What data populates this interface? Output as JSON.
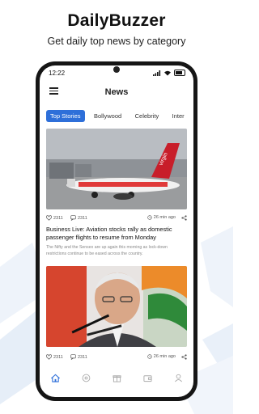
{
  "header": {
    "app_title": "DailyBuzzer",
    "subtitle": "Get daily top news by category"
  },
  "status_bar": {
    "time": "12:22"
  },
  "app_bar": {
    "title": "News",
    "menu_icon": "hamburger-menu-icon"
  },
  "tabs": [
    {
      "label": "Top Stories",
      "active": true
    },
    {
      "label": "Bollywood",
      "active": false
    },
    {
      "label": "Celebrity",
      "active": false
    },
    {
      "label": "Inter",
      "active": false
    }
  ],
  "articles": [
    {
      "image_icon": "airplane-photo",
      "likes": "2311",
      "comments": "2311",
      "time_ago": "26 min ago",
      "headline": "Business Live: Aviation stocks rally as domestic passenger flights to resume from Monday",
      "summary": "The Nifty and the Sensex are up again this morning as lock-down restrictions continue to be eased across the country."
    },
    {
      "image_icon": "speaker-at-microphone-photo",
      "likes": "2311",
      "comments": "2311",
      "time_ago": "26 min ago"
    }
  ],
  "bottom_nav": [
    {
      "icon": "home-icon",
      "active": true
    },
    {
      "icon": "category-icon",
      "active": false
    },
    {
      "icon": "gift-icon",
      "active": false
    },
    {
      "icon": "wallet-icon",
      "active": false
    },
    {
      "icon": "profile-icon",
      "active": false
    }
  ],
  "colors": {
    "accent": "#2e6fd9",
    "phone_frame": "#151515"
  }
}
